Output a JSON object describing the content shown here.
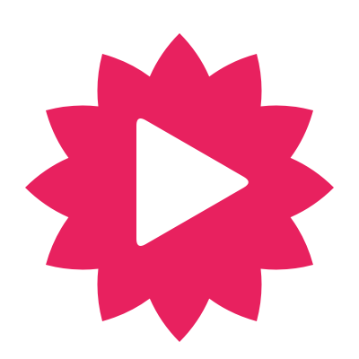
{
  "icon": {
    "name": "play-flower-icon",
    "petal_color": "#E8215F",
    "play_color": "#FFFFFF",
    "background_color": "#FFFFFF"
  }
}
